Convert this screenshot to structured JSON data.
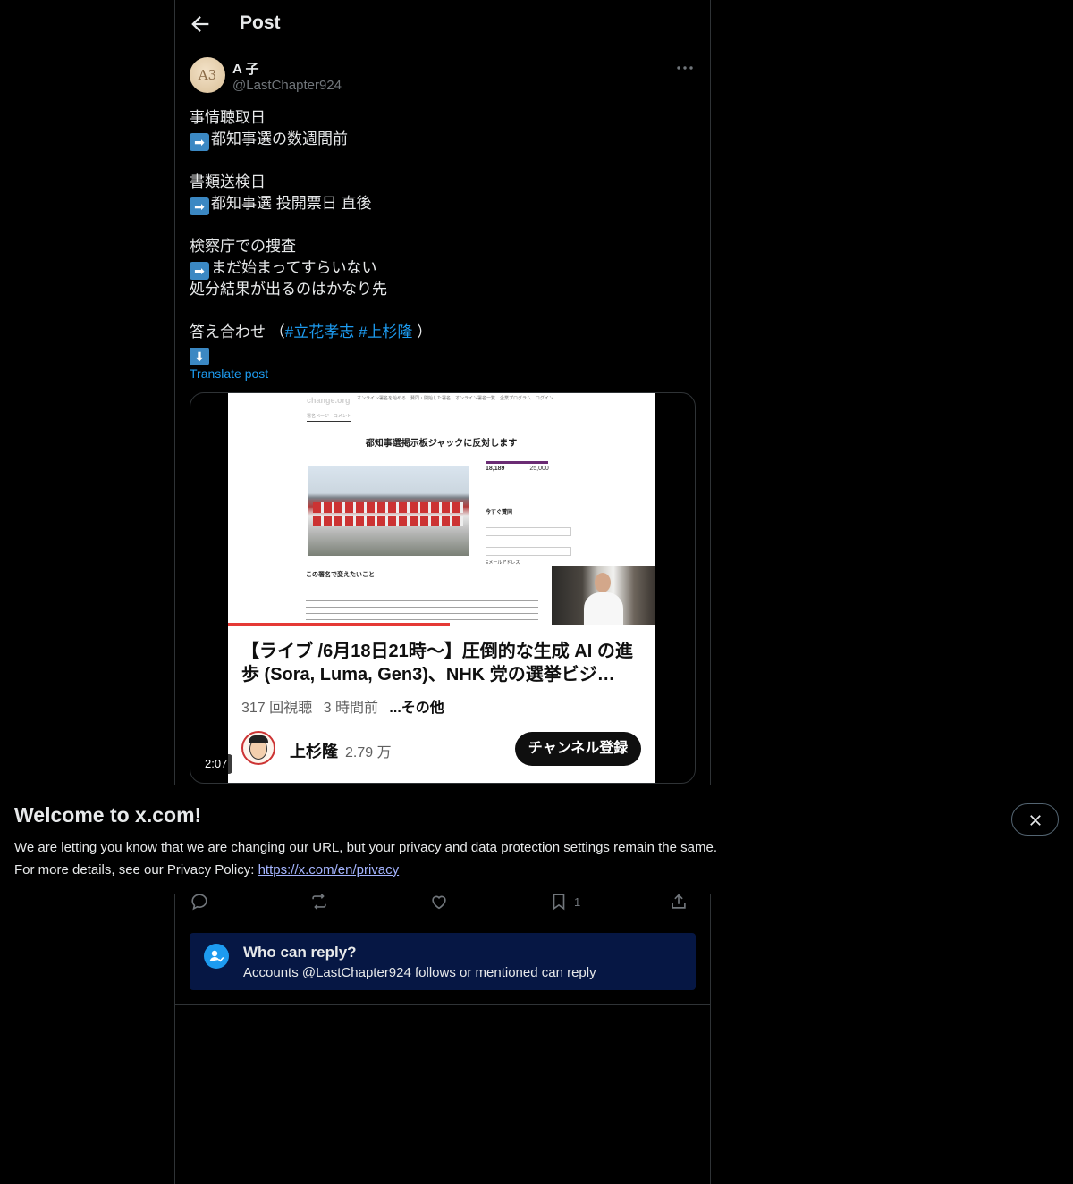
{
  "header": {
    "title": "Post"
  },
  "author": {
    "avatar_text": "A3",
    "name": "A 子",
    "handle": "@LastChapter924"
  },
  "post": {
    "lines": [
      "事情聴取日",
      "都知事選の数週間前",
      "書類送検日",
      "都知事選 投開票日 直後",
      "検察庁での捜査",
      "まだ始まってすらいない",
      "処分結果が出るのはかなり先",
      "答え合わせ （",
      "#立花孝志",
      "#上杉隆",
      "）"
    ],
    "emoji": {
      "right_arrow": "➡",
      "down_arrow": "⬇"
    },
    "translate_label": "Translate post"
  },
  "video": {
    "web_logo": "change.org",
    "web_nav": "オンライン署名を始める　賛同・開始した署名　オンライン署名一覧　企業プログラム　ログイン",
    "web_tabs": "署名ページ　コメント",
    "web_title": "都知事選掲示板ジャックに反対します",
    "web_count_current": "18,189",
    "web_count_goal": "25,000",
    "web_form_title": "今すぐ賛同",
    "web_section_title": "この署名で変えたいこと",
    "web_email_label": "Eメールアドレス",
    "yt_title": "【ライブ /6月18日21時〜】圧倒的な生成 AI の進歩 (Sora, Luma, Gen3)、NHK 党の選挙ビジ…",
    "yt_views": "317 回視聴",
    "yt_time": "3 時間前",
    "yt_more": "...その他",
    "yt_channel": "上杉隆",
    "yt_subs": "2.79 万",
    "yt_subscribe": "チャンネル登録",
    "duration": "2:07"
  },
  "actions": {
    "reply_count": "",
    "repost_count": "",
    "like_count": "",
    "bookmark_count": "1"
  },
  "who_can_reply": {
    "title": "Who can reply?",
    "subtitle": "Accounts @LastChapter924 follows or mentioned can reply"
  },
  "banner": {
    "title": "Welcome to x.com!",
    "line1": "We are letting you know that we are changing our URL, but your privacy and data protection settings remain the same.",
    "line2_prefix": "For more details, see our Privacy Policy: ",
    "link": "https://x.com/en/privacy"
  },
  "colors": {
    "background": "#000000",
    "text": "#e7e9ea",
    "muted": "#71767b",
    "accent": "#1d9bf0",
    "reply_box": "#061744"
  },
  "icons": [
    "back-arrow-icon",
    "more-icon",
    "reply-icon",
    "repost-icon",
    "like-icon",
    "bookmark-icon",
    "share-icon",
    "person-check-icon",
    "close-icon"
  ]
}
